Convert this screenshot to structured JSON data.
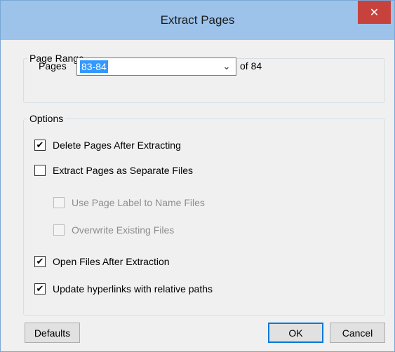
{
  "window": {
    "title": "Extract Pages",
    "close_glyph": "✕"
  },
  "page_range": {
    "legend": "Page Range",
    "pages_label": "Pages",
    "pages_value": "83-84",
    "of_label": "of 84",
    "dropdown_glyph": "⌄"
  },
  "options": {
    "legend": "Options",
    "items": [
      {
        "label": "Delete Pages After Extracting",
        "checked": true,
        "enabled": true
      },
      {
        "label": "Extract Pages as Separate Files",
        "checked": false,
        "enabled": true
      },
      {
        "label": "Use Page Label to Name Files",
        "checked": false,
        "enabled": false
      },
      {
        "label": "Overwrite Existing Files",
        "checked": false,
        "enabled": false
      },
      {
        "label": "Open Files After Extraction",
        "checked": true,
        "enabled": true
      },
      {
        "label": "Update hyperlinks with relative paths",
        "checked": true,
        "enabled": true
      }
    ]
  },
  "buttons": {
    "defaults": "Defaults",
    "ok": "OK",
    "cancel": "Cancel"
  }
}
